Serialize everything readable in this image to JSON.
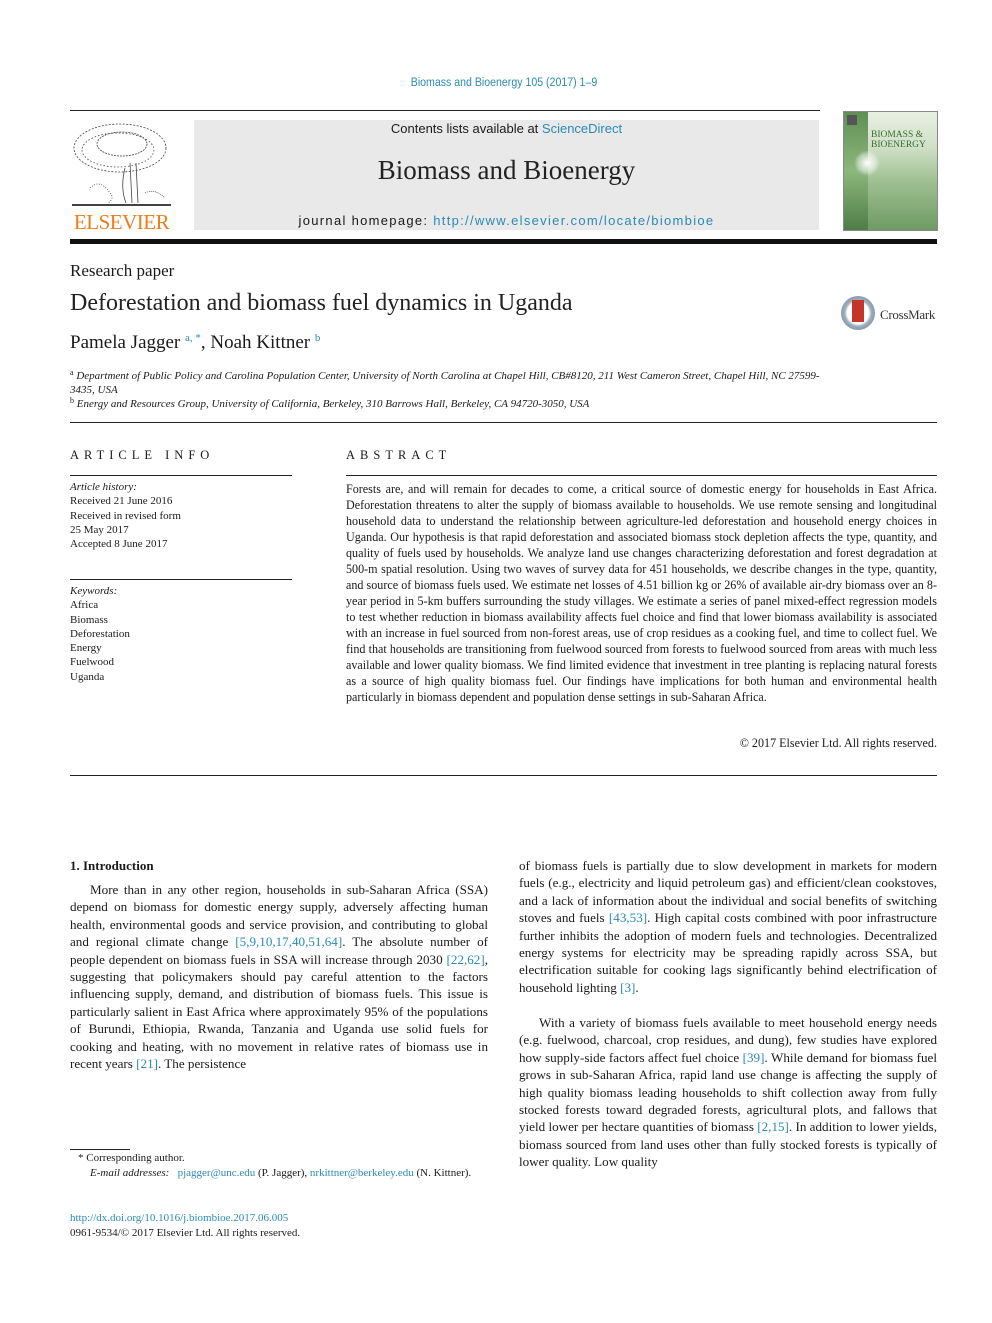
{
  "running_header": "Biomass and Bioenergy 105 (2017) 1–9",
  "journal_header": {
    "contents_prefix": "Contents lists available at ",
    "contents_link": "ScienceDirect",
    "journal_title": "Biomass and Bioenergy",
    "homepage_prefix": "journal homepage: ",
    "homepage_url": "http://www.elsevier.com/locate/biombioe",
    "publisher_logo_text": "ELSEVIER",
    "cover_title": "BIOMASS & BIOENERGY"
  },
  "article": {
    "type": "Research paper",
    "title": "Deforestation and biomass fuel dynamics in Uganda",
    "crossmark_label": "CrossMark",
    "authors": [
      {
        "name": "Pamela Jagger",
        "sup": "a, *"
      },
      {
        "name": "Noah Kittner",
        "sup": "b"
      }
    ],
    "author_separator": ", ",
    "affiliations": [
      {
        "mark": "a",
        "text": "Department of Public Policy and Carolina Population Center, University of North Carolina at Chapel Hill, CB#8120, 211 West Cameron Street, Chapel Hill, NC 27599-3435, USA"
      },
      {
        "mark": "b",
        "text": "Energy and Resources Group, University of California, Berkeley, 310 Barrows Hall, Berkeley, CA 94720-3050, USA"
      }
    ]
  },
  "article_info": {
    "heading": "ARTICLE INFO",
    "history_label": "Article history:",
    "history": [
      "Received 21 June 2016",
      "Received in revised form",
      "25 May 2017",
      "Accepted 8 June 2017"
    ],
    "keywords_label": "Keywords:",
    "keywords": [
      "Africa",
      "Biomass",
      "Deforestation",
      "Energy",
      "Fuelwood",
      "Uganda"
    ]
  },
  "abstract": {
    "heading": "ABSTRACT",
    "text": "Forests are, and will remain for decades to come, a critical source of domestic energy for households in East Africa. Deforestation threatens to alter the supply of biomass available to households. We use remote sensing and longitudinal household data to understand the relationship between agriculture-led deforestation and household energy choices in Uganda. Our hypothesis is that rapid deforestation and associated biomass stock depletion affects the type, quantity, and quality of fuels used by households. We analyze land use changes characterizing deforestation and forest degradation at 500-m spatial resolution. Using two waves of survey data for 451 households, we describe changes in the type, quantity, and source of biomass fuels used. We estimate net losses of 4.51 billion kg or 26% of available air-dry biomass over an 8-year period in 5-km buffers surrounding the study villages. We estimate a series of panel mixed-effect regression models to test whether reduction in biomass availability affects fuel choice and find that lower biomass availability is associated with an increase in fuel sourced from non-forest areas, use of crop residues as a cooking fuel, and time to collect fuel. We find that households are transitioning from fuelwood sourced from forests to fuelwood sourced from areas with much less available and lower quality biomass. We find limited evidence that investment in tree planting is replacing natural forests as a source of high quality biomass fuel. Our findings have implications for both human and environmental health particularly in biomass dependent and population dense settings in sub-Saharan Africa.",
    "copyright": "© 2017 Elsevier Ltd. All rights reserved."
  },
  "introduction": {
    "heading": "1.  Introduction",
    "p1": [
      {
        "t": "More than in any other region, households in sub-Saharan Africa (SSA) depend on biomass for domestic energy supply, adversely affecting human health, environmental goods and service provision, and contributing to global and regional climate change "
      },
      {
        "ref": "[5,9,10,17,40,51,64]"
      },
      {
        "t": ". The absolute number of people dependent on biomass fuels in SSA will increase through 2030 "
      },
      {
        "ref": "[22,62]"
      },
      {
        "t": ", suggesting that policymakers should pay careful attention to the factors influencing supply, demand, and distribution of biomass fuels. This issue is particularly salient in East Africa where approximately 95% of the populations of Burundi, Ethiopia, Rwanda, Tanzania and Uganda use solid fuels for cooking and heating, with no movement in relative rates of biomass use in recent years "
      },
      {
        "ref": "[21]"
      },
      {
        "t": ". The persistence"
      }
    ],
    "p1_cont": [
      {
        "t": "of biomass fuels is partially due to slow development in markets for modern fuels (e.g., electricity and liquid petroleum gas) and efficient/clean cookstoves, and a lack of information about the individual and social benefits of switching stoves and fuels "
      },
      {
        "ref": "[43,53]"
      },
      {
        "t": ". High capital costs combined with poor infrastructure further inhibits the adoption of modern fuels and technologies. Decentralized energy systems for electricity may be spreading rapidly across SSA, but electrification suitable for cooking lags significantly behind electrification of household lighting "
      },
      {
        "ref": "[3]"
      },
      {
        "t": "."
      }
    ],
    "p2": [
      {
        "t": "With a variety of biomass fuels available to meet household energy needs (e.g. fuelwood, charcoal, crop residues, and dung), few studies have explored how supply-side factors affect fuel choice "
      },
      {
        "ref": "[39]"
      },
      {
        "t": ". While demand for biomass fuel grows in sub-Saharan Africa, rapid land use change is affecting the supply of high quality biomass leading households to shift collection away from fully stocked forests toward degraded forests, agricultural plots, and fallows that yield lower per hectare quantities of biomass "
      },
      {
        "ref": "[2,15]"
      },
      {
        "t": ". In addition to lower yields, biomass sourced from land uses other than fully stocked forests is typically of lower quality. Low quality"
      }
    ]
  },
  "footnotes": {
    "corresponding": "* Corresponding author.",
    "email_label": "E-mail addresses:",
    "emails": [
      {
        "address": "pjagger@unc.edu",
        "owner": "(P. Jagger),"
      },
      {
        "address": "nrkittner@berkeley.edu",
        "owner": "(N. Kittner)."
      }
    ],
    "doi": "http://dx.doi.org/10.1016/j.biombioe.2017.06.005",
    "issn_copyright": "0961-9534/© 2017 Elsevier Ltd. All rights reserved."
  },
  "colors": {
    "link": "#2a8ab6",
    "elsevier_orange": "#f07d1a",
    "header_box": "#e9e9e9"
  }
}
